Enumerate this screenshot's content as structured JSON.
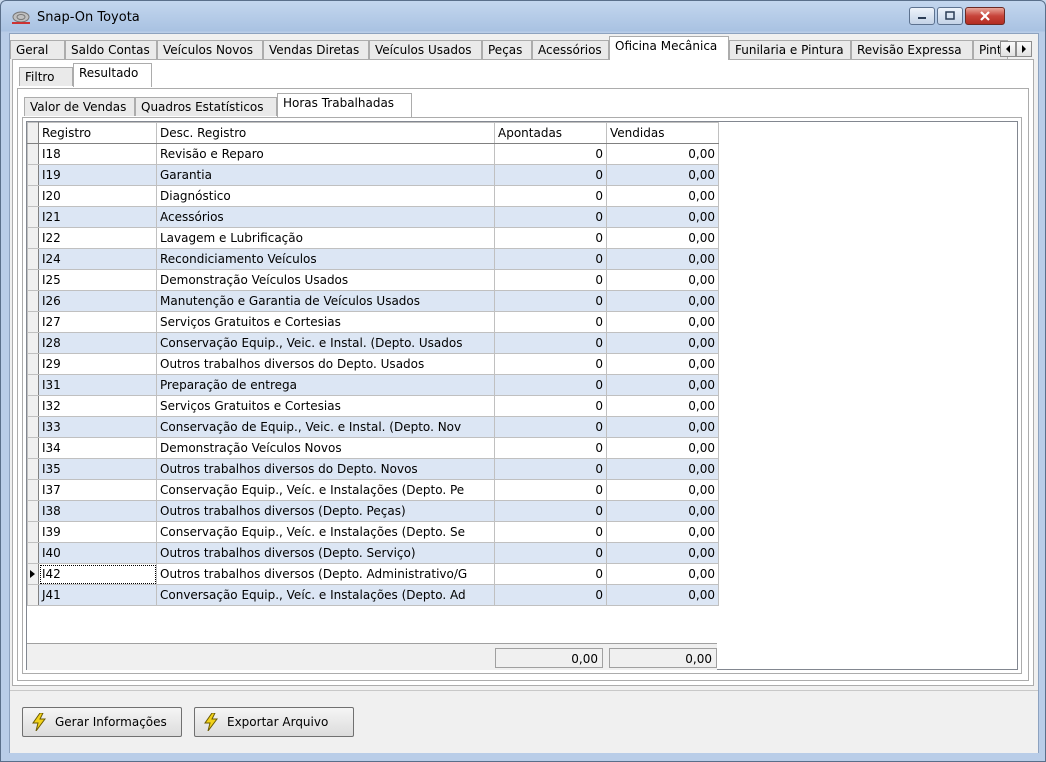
{
  "window": {
    "title": "Snap-On Toyota"
  },
  "tabs_main": [
    {
      "label": "Geral"
    },
    {
      "label": "Saldo Contas"
    },
    {
      "label": "Veículos Novos"
    },
    {
      "label": "Vendas Diretas"
    },
    {
      "label": "Veículos Usados"
    },
    {
      "label": "Peças"
    },
    {
      "label": "Acessórios"
    },
    {
      "label": "Oficina Mecânica"
    },
    {
      "label": "Funilaria e Pintura"
    },
    {
      "label": "Revisão Expressa"
    },
    {
      "label": "Pint"
    }
  ],
  "tabs_sub": [
    {
      "label": "Filtro"
    },
    {
      "label": "Resultado"
    }
  ],
  "tabs_result": [
    {
      "label": "Valor de Vendas"
    },
    {
      "label": "Quadros Estatísticos"
    },
    {
      "label": "Horas Trabalhadas"
    }
  ],
  "grid": {
    "columns": [
      "Registro",
      "Desc. Registro",
      "Apontadas",
      "Vendidas"
    ],
    "rows": [
      {
        "registro": "I18",
        "desc": "Revisão e Reparo",
        "apontadas": "0",
        "vendidas": "0,00"
      },
      {
        "registro": "I19",
        "desc": "Garantia",
        "apontadas": "0",
        "vendidas": "0,00"
      },
      {
        "registro": "I20",
        "desc": "Diagnóstico",
        "apontadas": "0",
        "vendidas": "0,00"
      },
      {
        "registro": "I21",
        "desc": "Acessórios",
        "apontadas": "0",
        "vendidas": "0,00"
      },
      {
        "registro": "I22",
        "desc": "Lavagem e Lubrificação",
        "apontadas": "0",
        "vendidas": "0,00"
      },
      {
        "registro": "I24",
        "desc": "Recondiciamento Veículos",
        "apontadas": "0",
        "vendidas": "0,00"
      },
      {
        "registro": "I25",
        "desc": "Demonstração Veículos Usados",
        "apontadas": "0",
        "vendidas": "0,00"
      },
      {
        "registro": "I26",
        "desc": "Manutenção e Garantia de Veículos Usados",
        "apontadas": "0",
        "vendidas": "0,00"
      },
      {
        "registro": "I27",
        "desc": "Serviços Gratuitos e Cortesias",
        "apontadas": "0",
        "vendidas": "0,00"
      },
      {
        "registro": "I28",
        "desc": "Conservação Equip., Veic. e Instal. (Depto. Usados",
        "apontadas": "0",
        "vendidas": "0,00"
      },
      {
        "registro": "I29",
        "desc": "Outros trabalhos diversos do Depto. Usados",
        "apontadas": "0",
        "vendidas": "0,00"
      },
      {
        "registro": "I31",
        "desc": "Preparação de entrega",
        "apontadas": "0",
        "vendidas": "0,00"
      },
      {
        "registro": "I32",
        "desc": "Serviços Gratuitos e Cortesias",
        "apontadas": "0",
        "vendidas": "0,00"
      },
      {
        "registro": "I33",
        "desc": "Conservação de Equip., Veic. e Instal. (Depto. Nov",
        "apontadas": "0",
        "vendidas": "0,00"
      },
      {
        "registro": "I34",
        "desc": "Demonstração Veículos Novos",
        "apontadas": "0",
        "vendidas": "0,00"
      },
      {
        "registro": "I35",
        "desc": "Outros trabalhos diversos do Depto. Novos",
        "apontadas": "0",
        "vendidas": "0,00"
      },
      {
        "registro": "I37",
        "desc": "Conservação Equip., Veíc. e Instalações (Depto. Pe",
        "apontadas": "0",
        "vendidas": "0,00"
      },
      {
        "registro": "I38",
        "desc": "Outros trabalhos diversos (Depto. Peças)",
        "apontadas": "0",
        "vendidas": "0,00"
      },
      {
        "registro": "I39",
        "desc": "Conservação Equip., Veíc. e Instalações (Depto. Se",
        "apontadas": "0",
        "vendidas": "0,00"
      },
      {
        "registro": "I40",
        "desc": "Outros trabalhos diversos (Depto. Serviço)",
        "apontadas": "0",
        "vendidas": "0,00"
      },
      {
        "registro": "I42",
        "desc": "Outros trabalhos diversos (Depto. Administrativo/G",
        "apontadas": "0",
        "vendidas": "0,00"
      },
      {
        "registro": "J41",
        "desc": "Conversação Equip., Veíc. e Instalações (Depto. Ad",
        "apontadas": "0",
        "vendidas": "0,00"
      }
    ],
    "totals": {
      "apontadas": "0,00",
      "vendidas": "0,00"
    }
  },
  "buttons": {
    "gerar": "Gerar Informações",
    "exportar": "Exportar Arquivo"
  },
  "icons": [
    "app-icon",
    "minimize-icon",
    "maximize-icon",
    "close-icon",
    "scroll-left-icon",
    "scroll-right-icon",
    "lightning-icon"
  ],
  "colors": {
    "row_alt": "#dce6f4",
    "close_button": "#c7443a",
    "bolt": "#e8c400"
  }
}
